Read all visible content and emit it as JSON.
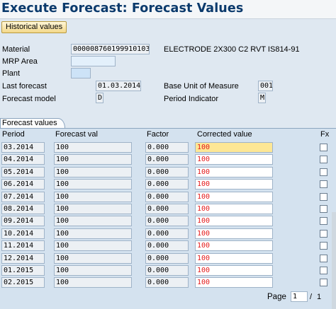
{
  "title": "Execute Forecast: Forecast Values",
  "toolbar": {
    "historical_values_label": "Historical values"
  },
  "header": {
    "material_label": "Material",
    "material_value": "000008760199910103",
    "material_desc": "ELECTRODE 2X300 C2 RVT IS814-91",
    "mrp_area_label": "MRP Area",
    "mrp_area_value": "",
    "plant_label": "Plant",
    "plant_value": "",
    "last_forecast_label": "Last forecast",
    "last_forecast_value": "01.03.2014",
    "base_uom_label": "Base Unit of Measure",
    "base_uom_value": "001",
    "forecast_model_label": "Forecast model",
    "forecast_model_value": "D",
    "period_indicator_label": "Period Indicator",
    "period_indicator_value": "M"
  },
  "tab": {
    "label": "Forecast values"
  },
  "table": {
    "columns": {
      "period": "Period",
      "forecast_val": "Forecast val",
      "factor": "Factor",
      "corrected_value": "Corrected value",
      "fx": "Fx"
    },
    "rows": [
      {
        "period": "03.2014",
        "forecast": "100",
        "factor": "0.000",
        "corrected": "100"
      },
      {
        "period": "04.2014",
        "forecast": "100",
        "factor": "0.000",
        "corrected": "100"
      },
      {
        "period": "05.2014",
        "forecast": "100",
        "factor": "0.000",
        "corrected": "100"
      },
      {
        "period": "06.2014",
        "forecast": "100",
        "factor": "0.000",
        "corrected": "100"
      },
      {
        "period": "07.2014",
        "forecast": "100",
        "factor": "0.000",
        "corrected": "100"
      },
      {
        "period": "08.2014",
        "forecast": "100",
        "factor": "0.000",
        "corrected": "100"
      },
      {
        "period": "09.2014",
        "forecast": "100",
        "factor": "0.000",
        "corrected": "100"
      },
      {
        "period": "10.2014",
        "forecast": "100",
        "factor": "0.000",
        "corrected": "100"
      },
      {
        "period": "11.2014",
        "forecast": "100",
        "factor": "0.000",
        "corrected": "100"
      },
      {
        "period": "12.2014",
        "forecast": "100",
        "factor": "0.000",
        "corrected": "100"
      },
      {
        "period": "01.2015",
        "forecast": "100",
        "factor": "0.000",
        "corrected": "100"
      },
      {
        "period": "02.2015",
        "forecast": "100",
        "factor": "0.000",
        "corrected": "100"
      }
    ]
  },
  "pager": {
    "label": "Page",
    "current": "1",
    "separator": "/",
    "total": "1"
  }
}
